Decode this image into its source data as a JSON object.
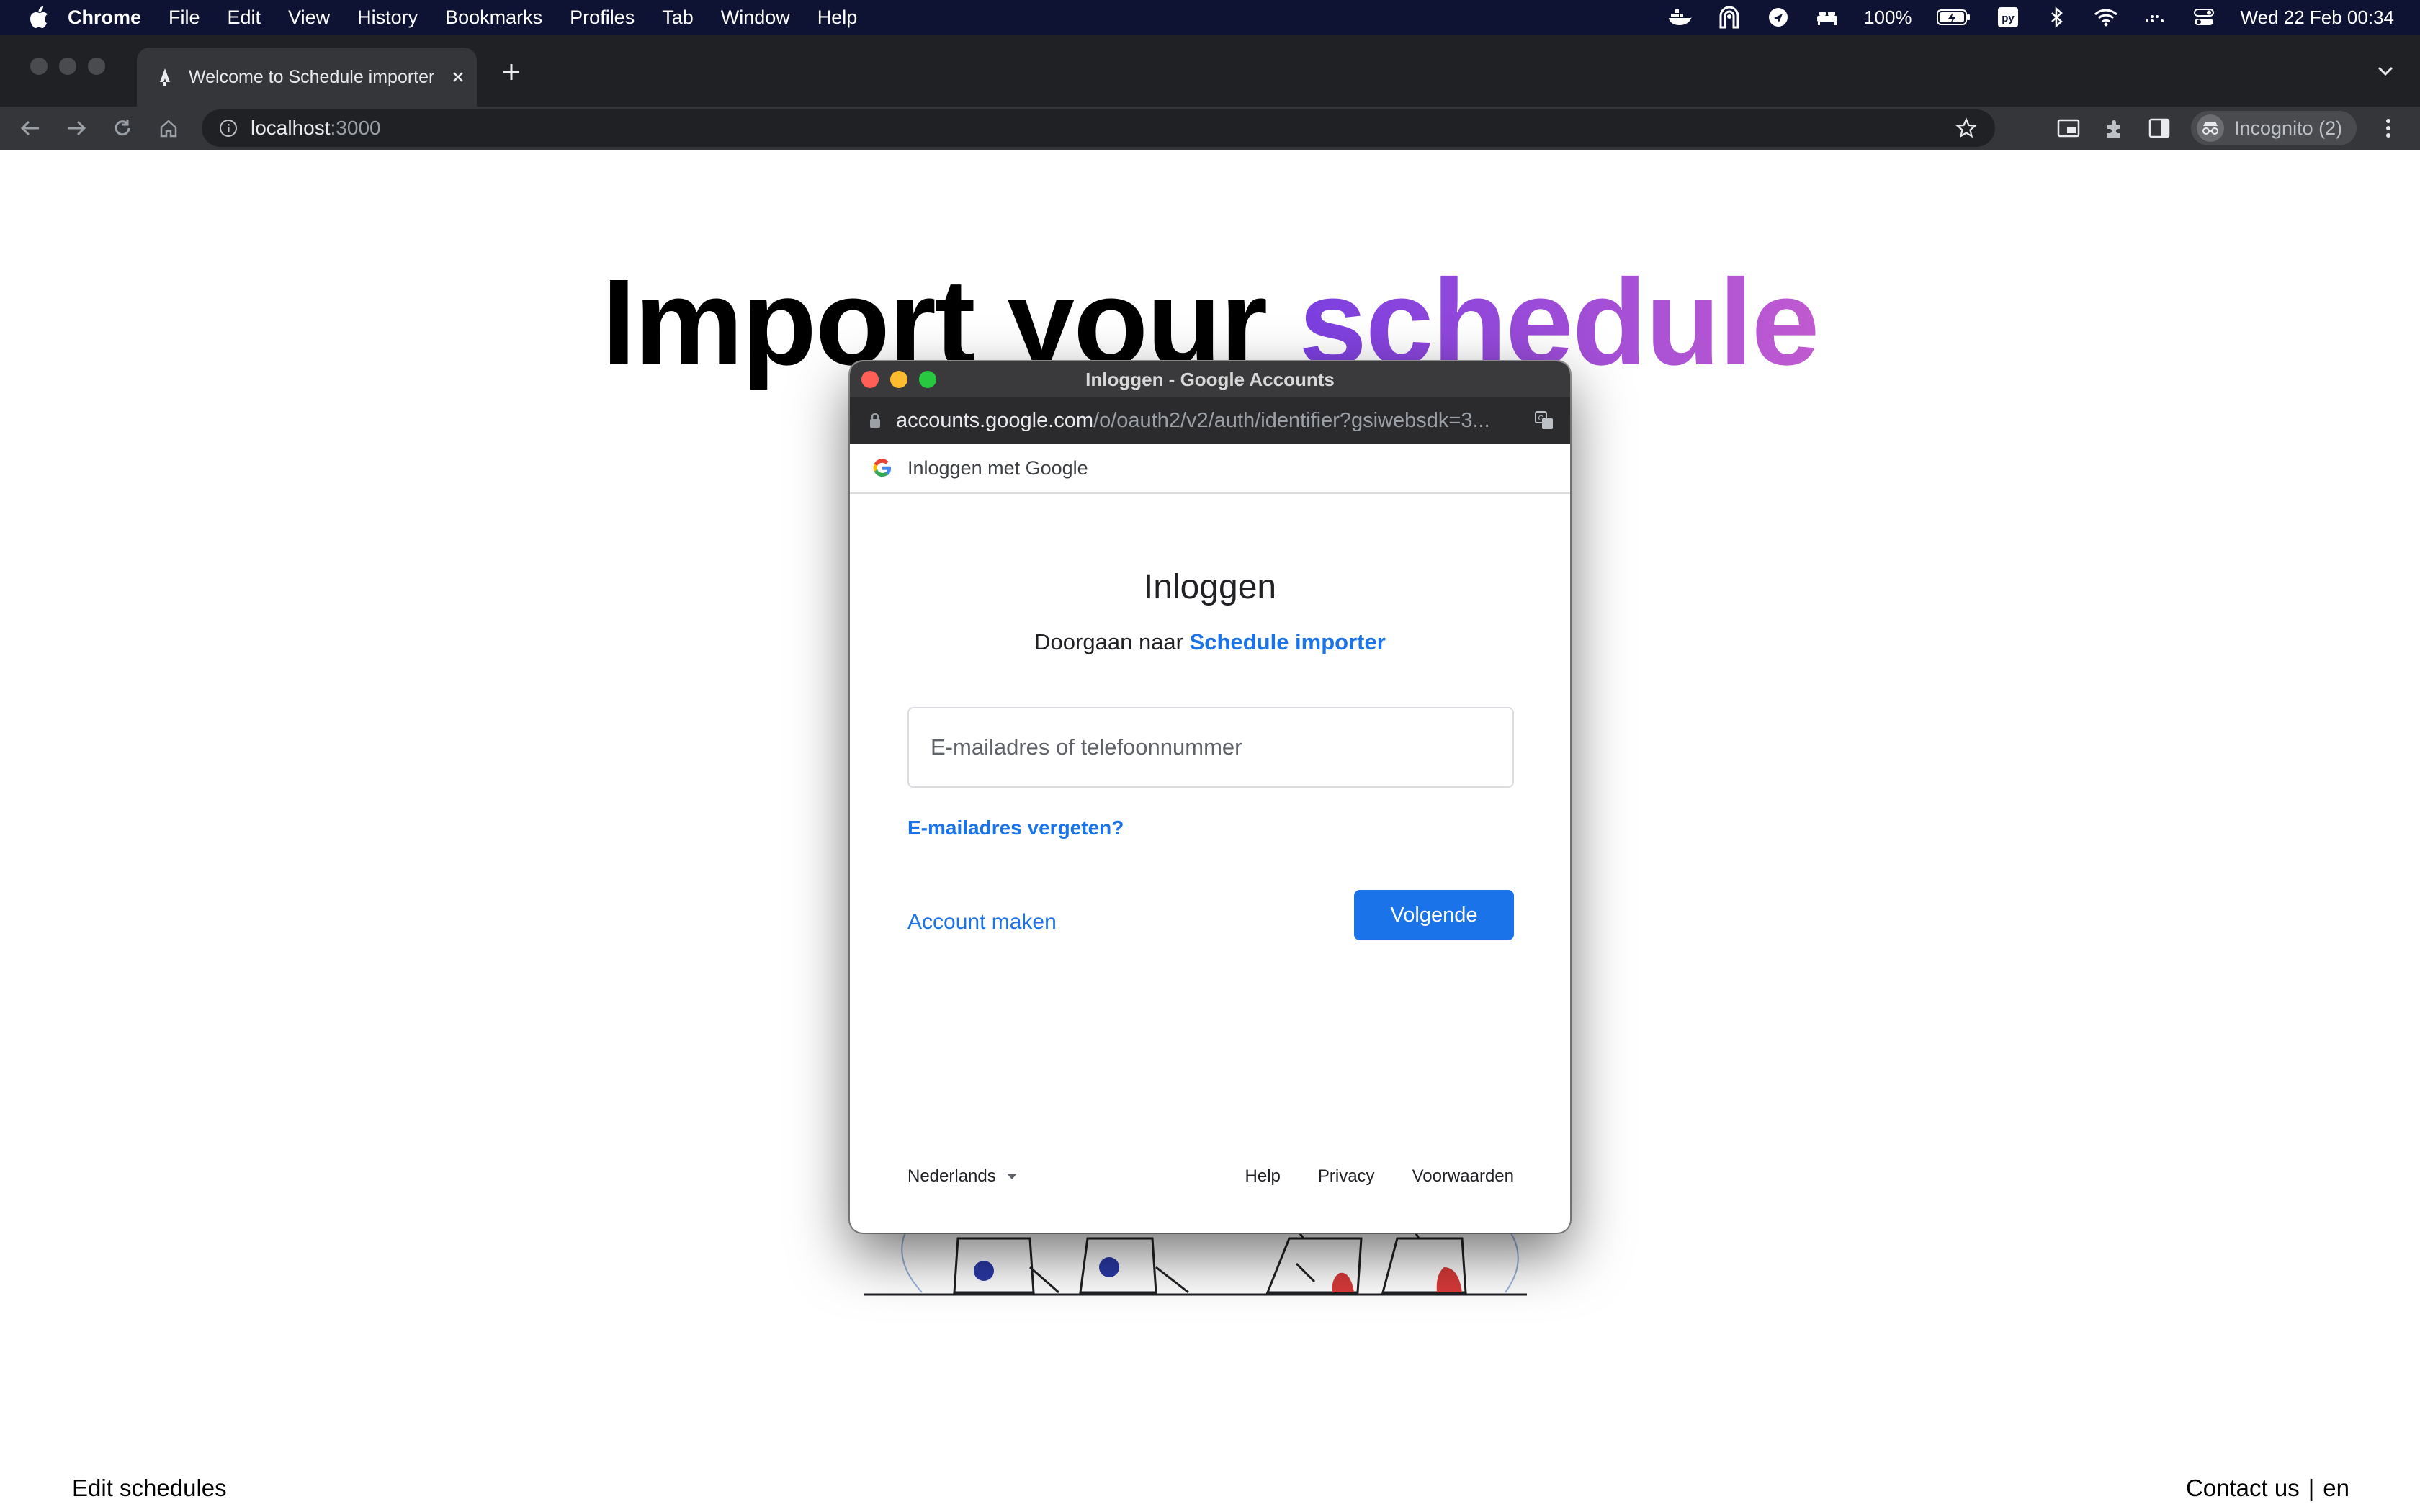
{
  "menubar": {
    "app_name": "Chrome",
    "items": [
      "File",
      "Edit",
      "View",
      "History",
      "Bookmarks",
      "Profiles",
      "Tab",
      "Window",
      "Help"
    ],
    "battery": "100%",
    "datetime": "Wed 22 Feb  00:34"
  },
  "browser": {
    "tab_title": "Welcome to Schedule importer",
    "url_host": "localhost",
    "url_port": ":3000",
    "profile_label": "Incognito (2)"
  },
  "page": {
    "hero_plain": "Import your",
    "hero_accent": "schedule",
    "footer_left": "Edit schedules",
    "footer_contact": "Contact us",
    "footer_separator": "|",
    "footer_lang": "en"
  },
  "popup": {
    "window_title": "Inloggen - Google Accounts",
    "url_host": "accounts.google.com",
    "url_path": "/o/oauth2/v2/auth/identifier?gsiwebsdk=3...",
    "header_text": "Inloggen met Google",
    "heading": "Inloggen",
    "subtitle_prefix": "Doorgaan naar",
    "subtitle_app": "Schedule importer",
    "email_placeholder": "E-mailadres of telefoonnummer",
    "forgot_email": "E-mailadres vergeten?",
    "create_account": "Account maken",
    "next_button": "Volgende",
    "language": "Nederlands",
    "footer_links": [
      "Help",
      "Privacy",
      "Voorwaarden"
    ]
  },
  "colors": {
    "accent_gradient_start": "#7b3fe0",
    "accent_gradient_end": "#c05ad0",
    "google_blue": "#1a73e8",
    "menubar_bg": "#0e1233"
  }
}
